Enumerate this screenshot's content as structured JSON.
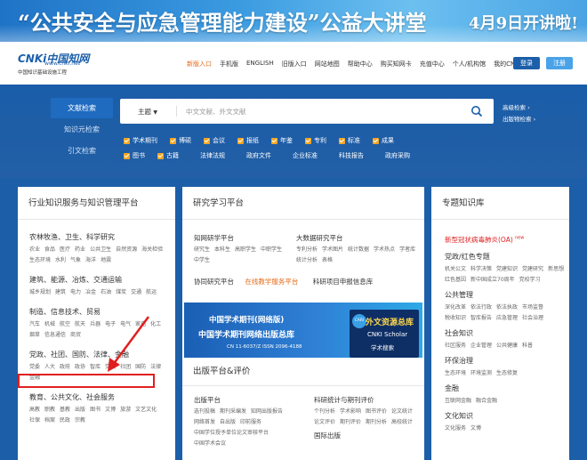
{
  "banner": {
    "title": "“公共安全与应急管理能力建设”公益大讲堂",
    "date": "4月9日开讲啦!"
  },
  "logo": {
    "name": "CNKi中国知网",
    "url": "www.cnki.net",
    "sub": "中国知识基础设施工程"
  },
  "nav": {
    "items": [
      "新版入口",
      "手机版",
      "ENGLISH",
      "旧版入口",
      "网站地图",
      "帮助中心",
      "购买知网卡",
      "充值中心",
      "个人/机构馆",
      "我的CNKI"
    ],
    "login": "登录",
    "register": "注册"
  },
  "search": {
    "side_tabs": [
      "文献检索",
      "知识元检索",
      "引文检索"
    ],
    "scope": "主题",
    "placeholder": "中文文献、外文文献",
    "advanced": "高级检索",
    "publish": "出版物检索",
    "checks_row1": [
      "学术期刊",
      "博硕",
      "会议",
      "报纸",
      "年鉴",
      "专利",
      "标准",
      "成果"
    ],
    "checks_row2": [
      "图书",
      "古籍",
      "法律法规",
      "政府文件",
      "企业标准",
      "科技报告",
      "政府采购"
    ]
  },
  "panel1": {
    "title": "行业知识服务与知识管理平台",
    "categories": [
      {
        "title": "农林牧渔、卫生、科学研究",
        "items": [
          "农业",
          "食品",
          "医疗",
          "药业",
          "公共卫生",
          "自然资源",
          "海关检验",
          "生态环境",
          "水利",
          "气象",
          "海洋",
          "地震"
        ]
      },
      {
        "title": "建筑、能源、冶炼、交通运输",
        "items": [
          "城乡规划",
          "建筑",
          "电力",
          "冶金",
          "石油",
          "煤炭",
          "交通",
          "航运"
        ]
      },
      {
        "title": "制造、信息技术、贸易",
        "items": [
          "汽车",
          "机械",
          "航空",
          "航天",
          "兵器",
          "电子",
          "电气",
          "家电",
          "化工",
          "烟草",
          "信息通信",
          "商贸"
        ]
      },
      {
        "title": "党政、社团、国防、法律、金融",
        "items": [
          "党委",
          "人大",
          "政府",
          "政协",
          "智库",
          "党校",
          "社团",
          "国防",
          "法律",
          "金融"
        ]
      },
      {
        "title": "教育、公共文化、社会服务",
        "items": [
          "高教",
          "职教",
          "基教",
          "出版",
          "图书",
          "文博",
          "旅游",
          "文艺文化",
          "社保",
          "档案",
          "民政",
          "宗教"
        ]
      }
    ]
  },
  "panel2": {
    "title": "研究学习平台",
    "block1_title": "知网研学平台",
    "block1_items": [
      "研究生",
      "本科生",
      "高职学生",
      "中职学生",
      "中学生"
    ],
    "block2_title": "大数据研究平台",
    "block2_items": [
      "专利分析",
      "学术图片",
      "统计数据",
      "学术热点",
      "学者库",
      "统计分析",
      "表格"
    ],
    "block3_title": "协同研究平台",
    "block3_link": "在线教学服务平台",
    "block3_right": "科研项目申报信息库",
    "promo_line1": "中国学术期刊(网络版)",
    "promo_line2": "中国学术期刊网络出版总库",
    "promo_line3": "CN 11-6037/Z   ISSN 2096-4188",
    "promo_cari": "CARI",
    "promo_r1": "外文资源总库",
    "promo_r2": "CNKI Scholar",
    "promo_r3": "学术搜索"
  },
  "panel3": {
    "title": "出版平台&评价",
    "left_title": "出版平台",
    "left_items": [
      "选刊投稿",
      "期刊采编发",
      "知网出版报告",
      "网络首发",
      "自出版",
      "印前服务",
      "中国学位授予单位论文审核平台",
      "中国学术会议"
    ],
    "right_title": "科研统计与期刊评价",
    "right_items": [
      "个刊分析",
      "学术影响",
      "图书评价",
      "论文统计",
      "论文评价",
      "期刊评价",
      "期刊分析",
      "高校统计"
    ],
    "right2_title": "国际出版"
  },
  "panel4": {
    "title": "专题知识库",
    "hot": "新型冠状病毒肺炎(OA)",
    "hot_tag": "new",
    "groups": [
      {
        "title": "党政/红色专题",
        "items": [
          "机关公文",
          "科学决策",
          "党建知识",
          "党建研究",
          "新思想",
          "红色基因",
          "新中国成立70周年",
          "党校学习"
        ]
      },
      {
        "title": "公共管理",
        "items": [
          "深化改革",
          "依法行政",
          "依法执政",
          "市场监督",
          "税收知识",
          "智库报告",
          "应急管理",
          "社会治理"
        ]
      },
      {
        "title": "社会知识",
        "items": [
          "社区服务",
          "企业管理",
          "公共健康",
          "科普"
        ]
      },
      {
        "title": "环保治理",
        "items": [
          "生态环境",
          "环境监测",
          "生态修复"
        ]
      },
      {
        "title": "金融",
        "items": [
          "互联网金融",
          "融合金融"
        ]
      },
      {
        "title": "文化知识",
        "items": [
          "文化服务",
          "文博"
        ]
      }
    ]
  }
}
